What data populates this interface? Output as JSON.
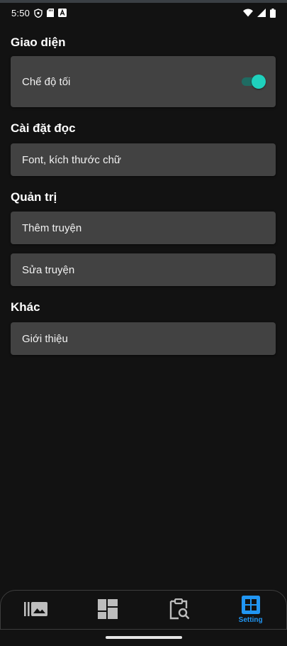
{
  "status_bar": {
    "time": "5:50",
    "icons": [
      "shield-icon",
      "sd-card-icon",
      "a-box-icon",
      "wifi-icon",
      "signal-icon",
      "battery-icon"
    ]
  },
  "sections": {
    "appearance": {
      "title": "Giao diện",
      "dark_mode_label": "Chế độ tối",
      "dark_mode_enabled": true
    },
    "reading": {
      "title": "Cài đặt đọc",
      "font_label": "Font, kích thước chữ"
    },
    "admin": {
      "title": "Quản trị",
      "add_story_label": "Thêm truyện",
      "edit_story_label": "Sửa truyện"
    },
    "other": {
      "title": "Khác",
      "about_label": "Giới thiệu"
    }
  },
  "bottom_nav": {
    "items": [
      {
        "icon": "library-icon",
        "label": "",
        "active": false
      },
      {
        "icon": "dashboard-icon",
        "label": "",
        "active": false
      },
      {
        "icon": "search-clipboard-icon",
        "label": "",
        "active": false
      },
      {
        "icon": "grid-icon",
        "label": "Setting",
        "active": true
      }
    ],
    "active_color": "#2196f3",
    "inactive_color": "#bdbdbd"
  },
  "colors": {
    "background": "#121212",
    "card": "#424242",
    "toggle_thumb": "#1fd1bd",
    "toggle_track": "#1f6b62"
  }
}
